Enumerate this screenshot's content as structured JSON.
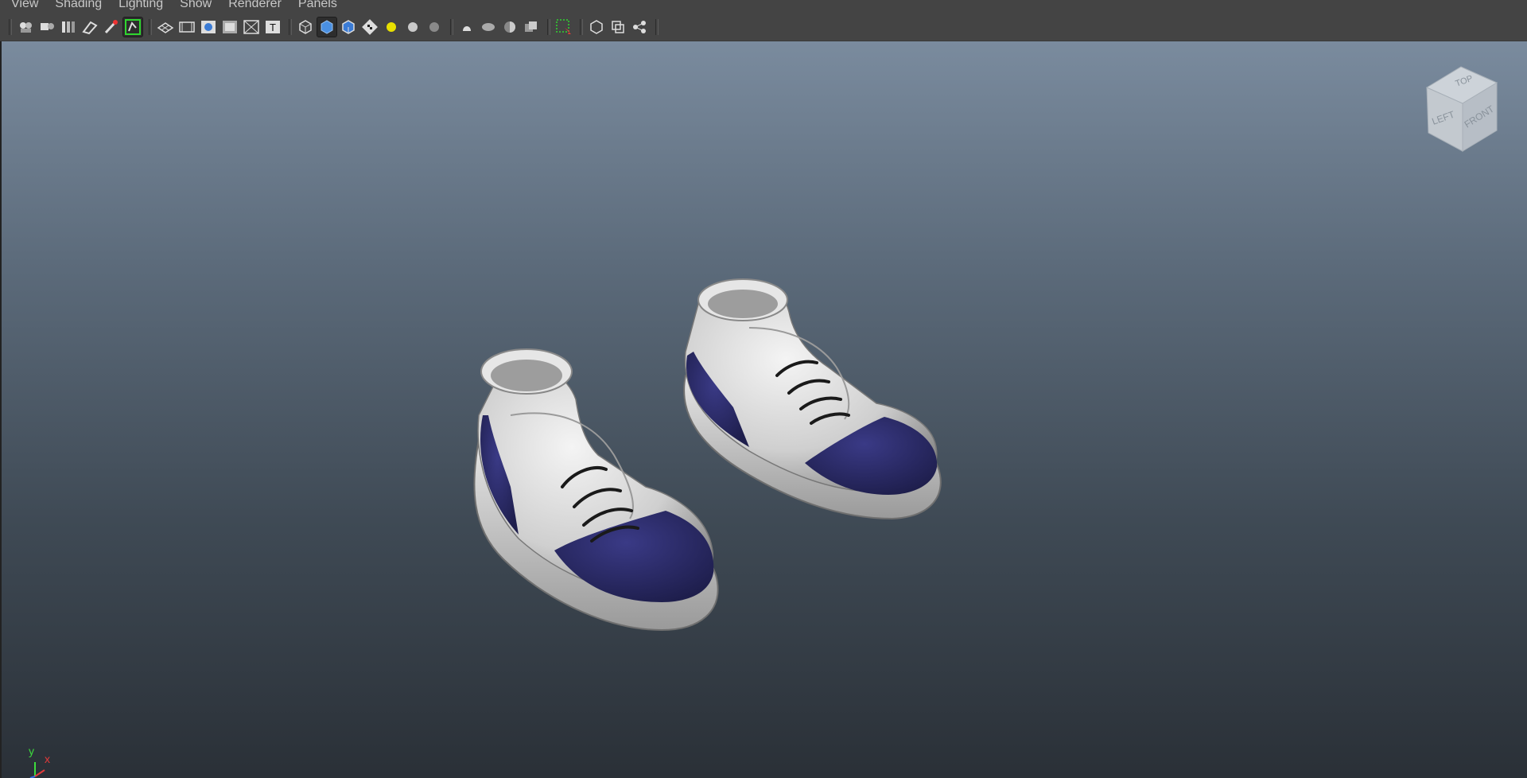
{
  "menus": [
    "View",
    "Shading",
    "Lighting",
    "Show",
    "Renderer",
    "Panels"
  ],
  "toolbar": {
    "groups": [
      [
        "camera-attributes-icon",
        "camera-bookmarks-icon",
        "image-plane-icon",
        "2d-pan-zoom-icon",
        "grease-pencil-icon",
        "film-gate-icon"
      ],
      [
        "grid-icon",
        "resolution-gate-icon",
        "gate-mask-icon",
        "field-chart-icon",
        "safe-action-icon",
        "safe-title-icon"
      ],
      [
        "wireframe-icon",
        "smooth-shade-icon",
        "wireframe-on-shaded-icon",
        "textured-icon",
        "use-all-lights-icon",
        "shadows-icon",
        "screen-space-ao-icon"
      ],
      [
        "motion-blur-icon",
        "multisample-aa-icon",
        "depth-of-field-icon",
        "ambient-occlusion-icon"
      ],
      [
        "isolate-select-icon"
      ],
      [
        "xray-icon",
        "xray-joints-icon",
        "xray-components-icon"
      ]
    ],
    "active": [
      "film-gate-icon",
      "smooth-shade-icon"
    ]
  },
  "viewcube": {
    "top_label": "TOP",
    "left_label": "LEFT",
    "front_label": "FRONT"
  },
  "axis": {
    "y_label": "y",
    "x_label": "x",
    "y_color": "#3ddc3d",
    "x_color": "#e23a3a"
  },
  "colors": {
    "shoe_body": "#d9d9d9",
    "shoe_accent": "#27275e",
    "lace": "#1a1a1a"
  }
}
